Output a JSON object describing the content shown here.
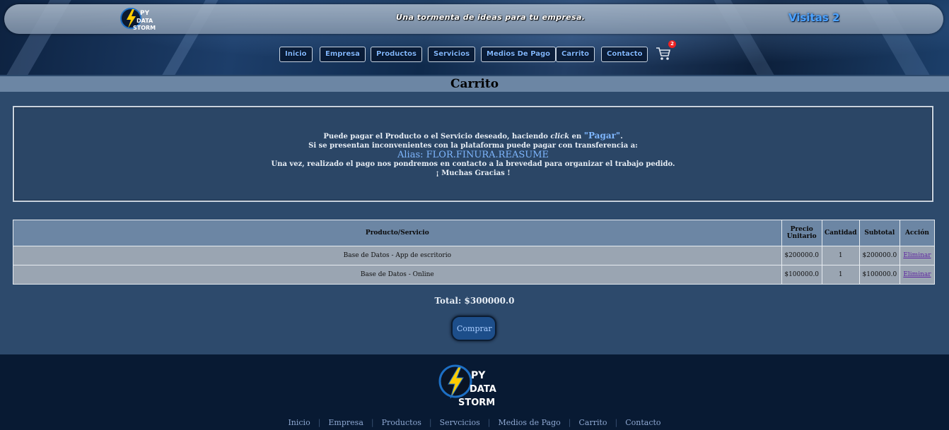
{
  "header": {
    "logo_text": [
      "PY",
      "DATA",
      "STORM"
    ],
    "tagline": "Una tormenta de ideas para tu empresa.",
    "visits": "Visitas 2"
  },
  "nav": [
    "Inicio",
    "Empresa",
    "Productos",
    "Servicios",
    "Medios De Pago",
    "Carrito",
    "Contacto"
  ],
  "cart_badge": "2",
  "page_title": "Carrito",
  "info": {
    "line1_a": "Puede pagar el Producto o el Servicio deseado, haciendo ",
    "line1_click": "click",
    "line1_b": " en ",
    "line1_pagar": "\"Pagar\"",
    "line1_end": ".",
    "line2": "Si se presentan inconvenientes con la plataforma puede pagar con transferencia a:",
    "alias": "Alias: FLOR.FINURA.REASUME",
    "line4": "Una vez, realizado el pago nos pondremos en contacto a la brevedad para organizar el trabajo pedido.",
    "line5": "¡ Muchas Gracias !"
  },
  "table": {
    "headers": [
      "Producto/Servicio",
      "Precio Unitario",
      "Cantidad",
      "Subtotal",
      "Acción"
    ],
    "rows": [
      {
        "product": "Base de Datos - App de escritorio",
        "price": "$200000.0",
        "qty": "1",
        "subtotal": "$200000.0",
        "action": "Eliminar"
      },
      {
        "product": "Base de Datos - Online",
        "price": "$100000.0",
        "qty": "1",
        "subtotal": "$100000.0",
        "action": "Eliminar"
      }
    ]
  },
  "total": "Total: $300000.0",
  "buy_button": "Comprar",
  "footer": {
    "logo_text": [
      "PY",
      "DATA",
      "STORM"
    ],
    "links": [
      "Inicio",
      "Empresa",
      "Productos",
      "Servcicios",
      "Medios de Pago",
      "Carrito",
      "Contacto"
    ]
  },
  "colors": {
    "accent_blue": "#4da3ff",
    "body_bg": "#2d4a6c",
    "footer_bg": "#081a33",
    "title_band": "#6c86a4"
  }
}
